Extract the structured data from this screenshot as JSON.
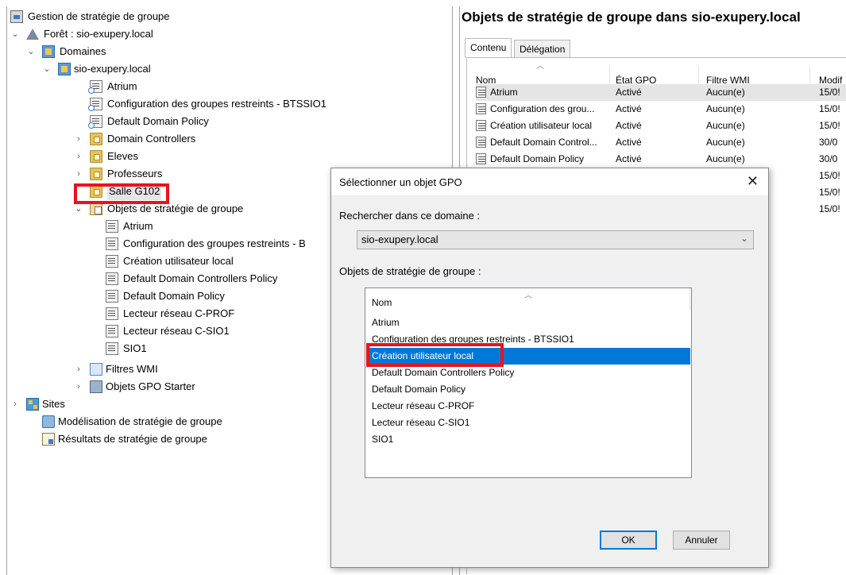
{
  "tree": {
    "root": "Gestion de stratégie de groupe",
    "forest": "Forêt : sio-exupery.local",
    "domains": "Domaines",
    "domain": "sio-exupery.local",
    "domain_links": [
      "Atrium",
      "Configuration des groupes restreints - BTSSIO1",
      "Default Domain Policy"
    ],
    "ous": [
      "Domain Controllers",
      "Eleves",
      "Professeurs",
      "Salle G102"
    ],
    "gpo_container": "Objets de stratégie de groupe",
    "gpos": [
      "Atrium",
      "Configuration des groupes restreints - B",
      "Création utilisateur local",
      "Default Domain Controllers Policy",
      "Default Domain Policy",
      "Lecteur réseau C-PROF",
      "Lecteur réseau C-SIO1",
      "SIO1"
    ],
    "wmi": "Filtres WMI",
    "starter": "Objets GPO Starter",
    "sites": "Sites",
    "modeling": "Modélisation de stratégie de groupe",
    "results": "Résultats de stratégie de groupe"
  },
  "right_pane": {
    "title": "Objets de stratégie de groupe dans sio-exupery.local",
    "tabs": [
      "Contenu",
      "Délégation"
    ],
    "columns": [
      "Nom",
      "État GPO",
      "Filtre WMI",
      "Modif"
    ],
    "rows": [
      {
        "name": "Atrium",
        "state": "Activé",
        "wmi": "Aucun(e)",
        "mod": "15/0!"
      },
      {
        "name": "Configuration des grou...",
        "state": "Activé",
        "wmi": "Aucun(e)",
        "mod": "15/0!"
      },
      {
        "name": "Création utilisateur local",
        "state": "Activé",
        "wmi": "Aucun(e)",
        "mod": "15/0!"
      },
      {
        "name": "Default Domain Control...",
        "state": "Activé",
        "wmi": "Aucun(e)",
        "mod": "30/0"
      },
      {
        "name": "Default Domain Policy",
        "state": "Activé",
        "wmi": "Aucun(e)",
        "mod": "30/0"
      }
    ],
    "extra_mods": [
      "15/0!",
      "15/0!",
      "15/0!"
    ]
  },
  "dialog": {
    "title": "Sélectionner un objet GPO",
    "close": "✕",
    "search_label": "Rechercher dans ce domaine :",
    "domain_value": "sio-exupery.local",
    "list_label": "Objets de stratégie de groupe :",
    "list_header": "Nom",
    "items": [
      "Atrium",
      "Configuration des groupes restreints - BTSSIO1",
      "Création utilisateur local",
      "Default Domain Controllers Policy",
      "Default Domain Policy",
      "Lecteur réseau C-PROF",
      "Lecteur réseau C-SIO1",
      "SIO1"
    ],
    "selected_index": 2,
    "ok": "OK",
    "cancel": "Annuler"
  },
  "colors": {
    "highlight": "#e8141c",
    "selection": "#0078d7"
  }
}
